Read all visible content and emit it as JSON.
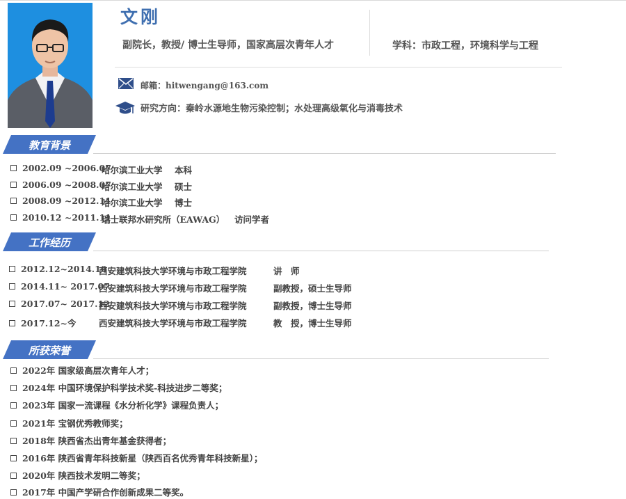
{
  "profile": {
    "name": "文刚",
    "title": "副院长，教授/ 博士生导师，国家高层次青年人才",
    "discipline": "学科：市政工程，环境科学与工程",
    "email": "邮箱：hitwengang@163.com",
    "research": "研究方向：秦岭水源地生物污染控制；水处理高级氧化与消毒技术"
  },
  "education": {
    "heading": "教育背景",
    "items": [
      {
        "period": "2002.09 ~2006.07",
        "school": "哈尔滨工业大学",
        "degree": "本科"
      },
      {
        "period": "2006.09 ~2008.07",
        "school": "哈尔滨工业大学",
        "degree": "硕士"
      },
      {
        "period": "2008.09 ~2012.11",
        "school": "哈尔滨工业大学",
        "degree": "博士"
      },
      {
        "period": "2010.12 ~2011.11",
        "school": "瑞士联邦水研究所（EAWAG）",
        "degree": "访问学者"
      }
    ]
  },
  "work": {
    "heading": "工作经历",
    "items": [
      {
        "period": "2012.12~2014.10",
        "org": "西安建筑科技大学环境与市政工程学院",
        "role": "讲　师"
      },
      {
        "period": "2014.11~ 2017.07",
        "org": "西安建筑科技大学环境与市政工程学院",
        "role": "副教授，硕士生导师"
      },
      {
        "period": "2017.07~ 2017.12",
        "org": "西安建筑科技大学环境与市政工程学院",
        "role": "副教授，博士生导师"
      },
      {
        "period": "2017.12~今",
        "org": "西安建筑科技大学环境与市政工程学院",
        "role": "教　授，博士生导师"
      }
    ]
  },
  "honors": {
    "heading": "所获荣誉",
    "items": [
      "2022年 国家级高层次青年人才；",
      "2024年 中国环境保护科学技术奖-科技进步二等奖；",
      "2023年 国家一流课程《水分析化学》课程负责人；",
      "2021年 宝钢优秀教师奖；",
      "2018年 陕西省杰出青年基金获得者；",
      "2016年 陕西省青年科技新星（陕西百名优秀青年科技新星）；",
      "2020年 陕西技术发明二等奖；",
      "2017年 中国产学研合作创新成果二等奖。"
    ]
  },
  "colors": {
    "accent": "#4472c4",
    "name": "#3f6fb0",
    "photo_bg": "#1e8fe0"
  },
  "icons": {
    "mail": "envelope-icon",
    "research": "graduation-cap-icon",
    "bullet": "square-bullet-icon"
  }
}
